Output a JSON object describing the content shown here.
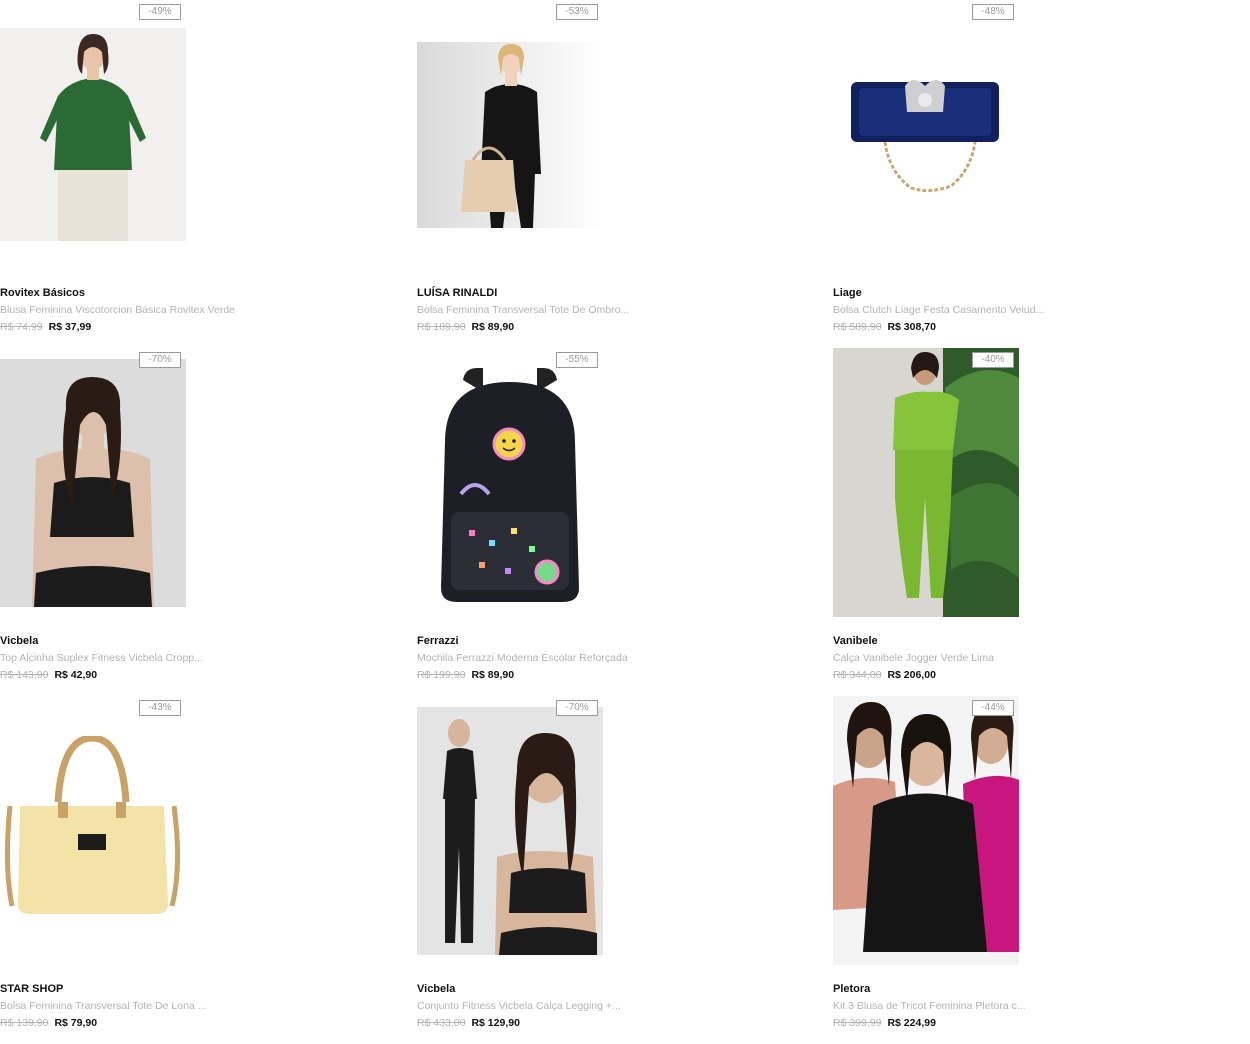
{
  "products": [
    {
      "brand": "Rovitex Básicos",
      "name": "Blusa Feminina Viscotorcion Básica Rovitex Verde",
      "old_price": "R$ 74,99",
      "new_price": "R$ 37,99",
      "discount": "-49%",
      "image": "woman-green-tshirt"
    },
    {
      "brand": "LUÍSA RINALDI",
      "name": "Bolsa Feminina Transversal Tote De Ombro...",
      "old_price": "R$ 189,90",
      "new_price": "R$ 89,90",
      "discount": "-53%",
      "image": "woman-beige-handbag"
    },
    {
      "brand": "Liage",
      "name": "Bolsa Clutch Liage Festa Casamento Velud...",
      "old_price": "R$ 589,90",
      "new_price": "R$ 308,70",
      "discount": "-48%",
      "image": "navy-velvet-clutch"
    },
    {
      "brand": "Vicbela",
      "name": "Top Alcinha Suplex Fitness Vicbela Cropp...",
      "old_price": "R$ 143,90",
      "new_price": "R$ 42,90",
      "discount": "-70%",
      "image": "woman-black-sport-top"
    },
    {
      "brand": "Ferrazzi",
      "name": "Mochila Ferrazzi Moderna Escolar Reforçada",
      "old_price": "R$ 199,90",
      "new_price": "R$ 89,90",
      "discount": "-55%",
      "image": "black-school-backpack"
    },
    {
      "brand": "Vanibele",
      "name": "Calça Vanibele Jogger Verde Lima",
      "old_price": "R$ 344,00",
      "new_price": "R$ 206,00",
      "discount": "-40%",
      "image": "woman-lime-jogger"
    },
    {
      "brand": "STAR SHOP",
      "name": "Bolsa Feminina Transversal Tote De Lona ...",
      "old_price": "R$ 139,90",
      "new_price": "R$ 79,90",
      "discount": "-43%",
      "image": "yellow-canvas-tote"
    },
    {
      "brand": "Vicbela",
      "name": "Conjunto Fitness Vicbela Calça Legging +...",
      "old_price": "R$ 433,00",
      "new_price": "R$ 129,90",
      "discount": "-70%",
      "image": "woman-black-fitness-set"
    },
    {
      "brand": "Pletora",
      "name": "Kit 3 Blusa de Tricot Feminina Pletora c...",
      "old_price": "R$ 399,99",
      "new_price": "R$ 224,99",
      "discount": "-44%",
      "image": "three-women-knit-sweaters"
    }
  ]
}
